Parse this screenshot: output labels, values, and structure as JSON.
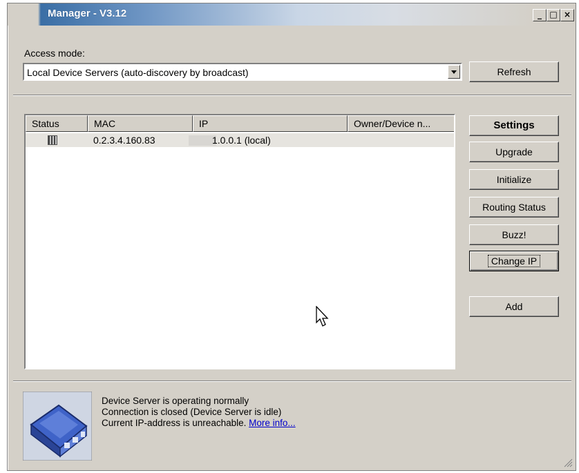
{
  "window": {
    "title": "Manager - V3.12",
    "controls": {
      "minimize": "_",
      "maximize": "□",
      "close": "×"
    }
  },
  "access": {
    "label": "Access mode:",
    "selected": "Local Device Servers (auto-discovery by broadcast)",
    "refresh_label": "Refresh"
  },
  "table": {
    "columns": [
      "Status",
      "MAC",
      "IP",
      "Owner/Device n..."
    ],
    "rows": [
      {
        "status_icon": "device-status-icon",
        "mac": "0.2.3.4.160.83",
        "ip": "1.0.0.1 (local)",
        "owner": ""
      }
    ]
  },
  "buttons": {
    "settings": "Settings",
    "upgrade": "Upgrade",
    "initialize": "Initialize",
    "routing_status": "Routing Status",
    "buzz": "Buzz!",
    "change_ip": "Change IP",
    "add": "Add"
  },
  "status": {
    "line1": "Device Server is operating normally",
    "line2": "Connection is closed (Device Server is idle)",
    "line3": "Current IP-address is unreachable.",
    "more_info": "More info..."
  },
  "icons": {
    "device": "device-server-icon",
    "resize": "resize-grip-icon",
    "cursor": "mouse-pointer-icon"
  }
}
